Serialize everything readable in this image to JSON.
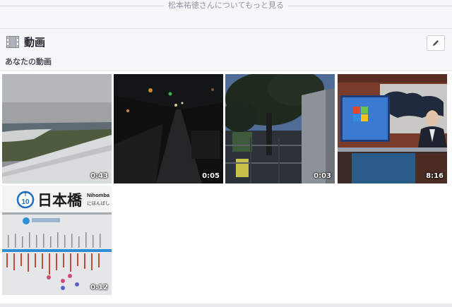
{
  "top_link": "松本祐徳さんについてもっと見る",
  "section": {
    "icon": "film-icon",
    "title": "動画",
    "edit_icon": "pencil-icon",
    "subtab": "あなたの動画"
  },
  "videos": [
    {
      "id": "airplane-wing",
      "duration": "0:43"
    },
    {
      "id": "night-street",
      "duration": "0:05"
    },
    {
      "id": "tree-evening",
      "duration": "0:03"
    },
    {
      "id": "news-studio",
      "duration": "8:16"
    },
    {
      "id": "nihombashi-sign",
      "duration": "0:12",
      "sign_number": "10",
      "sign_kanji": "日本橋",
      "sign_romaji": "Nihomba",
      "sign_kana": "にほんばし"
    }
  ]
}
